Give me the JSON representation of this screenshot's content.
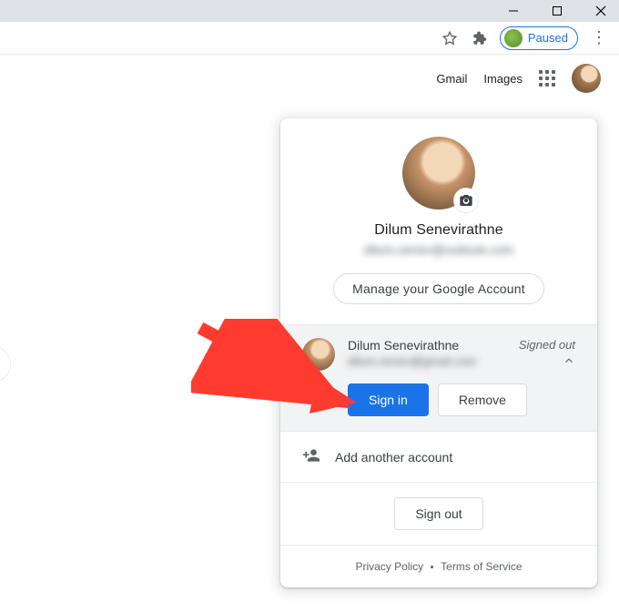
{
  "titlebar": {
    "minimize": "minimize",
    "maximize": "maximize",
    "close": "close"
  },
  "addrbar": {
    "paused_label": "Paused"
  },
  "topnav": {
    "gmail": "Gmail",
    "images": "Images"
  },
  "popup": {
    "primary_name": "Dilum Senevirathne",
    "primary_email": "dilum.senev@outlook.com",
    "manage_label": "Manage your Google Account",
    "secondary": {
      "name": "Dilum Senevirathne",
      "email": "dilum.senev@gmail.com",
      "status": "Signed out",
      "signin_label": "Sign in",
      "remove_label": "Remove"
    },
    "add_label": "Add another account",
    "signout_label": "Sign out",
    "privacy": "Privacy Policy",
    "terms": "Terms of Service"
  }
}
